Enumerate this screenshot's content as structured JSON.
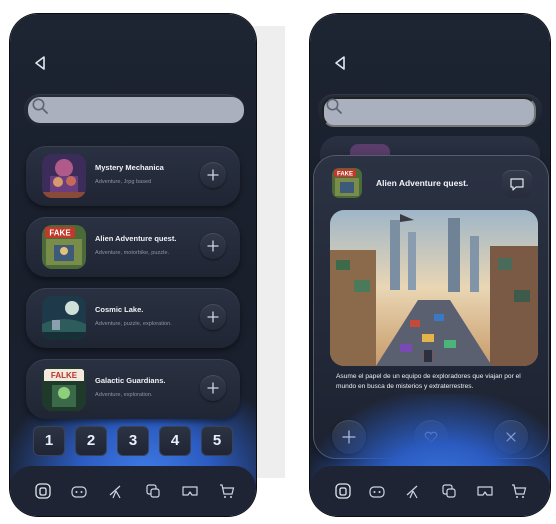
{
  "colors": {
    "accent": "#3f7be6",
    "panel": "#1d2432",
    "card": "#2a3142",
    "search_fill": "#aab0bd"
  },
  "library": {
    "search": {
      "placeholder": ""
    },
    "games": [
      {
        "title": "Mystery Mechanica",
        "subtitle": "Adventure, Jrpg based",
        "thumb": "mystery-mechanica-art"
      },
      {
        "title": "Alien Adventure quest.",
        "subtitle": "Adventure, motorbike, puzzle.",
        "thumb": "alien-adventure-art"
      },
      {
        "title": "Cosmic Lake.",
        "subtitle": "Adventure, puzzle, exploration.",
        "thumb": "cosmic-lake-art"
      },
      {
        "title": "Galactic Guardians.",
        "subtitle": "Adventure, exploration.",
        "thumb": "galactic-guardians-art"
      }
    ],
    "pages": [
      "1",
      "2",
      "3",
      "4",
      "5"
    ],
    "fake_label": "FAKE",
    "falke_label": "FALKE"
  },
  "detail": {
    "title": "Alien Adventure quest.",
    "description": "Asume el papel de un equipo de exploradores que viajan por el mundo en busca de misterios y extraterrestres.",
    "actions": [
      "plus-icon",
      "heart-icon",
      "close-icon"
    ]
  },
  "nav": [
    "home-icon",
    "gamepad-icon",
    "telescope-icon",
    "dice-icon",
    "vr-headset-icon",
    "cart-icon"
  ]
}
